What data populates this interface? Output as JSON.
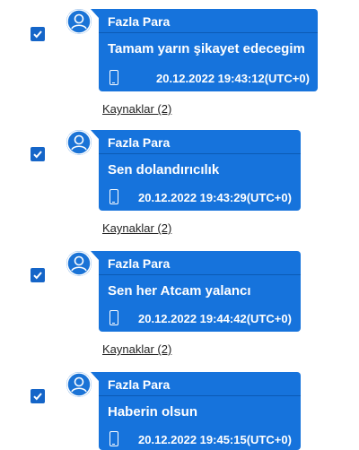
{
  "colors": {
    "bubble": "#1673dc",
    "checkbox": "#1565c8",
    "divider": "#0b5ab4"
  },
  "icons": {
    "avatar": "user-avatar-icon",
    "device": "phone-icon",
    "check": "checkmark-icon"
  },
  "messages": [
    {
      "checked": true,
      "sender": "Fazla Para",
      "text": "Tamam yarın şikayet edecegim",
      "timestamp": "20.12.2022 19:43:12(UTC+0)",
      "sources_label": "Kaynaklar (2)"
    },
    {
      "checked": true,
      "sender": "Fazla Para",
      "text": "Sen dolandırıcılık",
      "timestamp": "20.12.2022 19:43:29(UTC+0)",
      "sources_label": "Kaynaklar (2)"
    },
    {
      "checked": true,
      "sender": "Fazla Para",
      "text": "Sen her Atcam yalancı",
      "timestamp": "20.12.2022 19:44:42(UTC+0)",
      "sources_label": "Kaynaklar (2)"
    },
    {
      "checked": true,
      "sender": "Fazla Para",
      "text": "Haberin olsun",
      "timestamp": "20.12.2022 19:45:15(UTC+0)"
    }
  ]
}
